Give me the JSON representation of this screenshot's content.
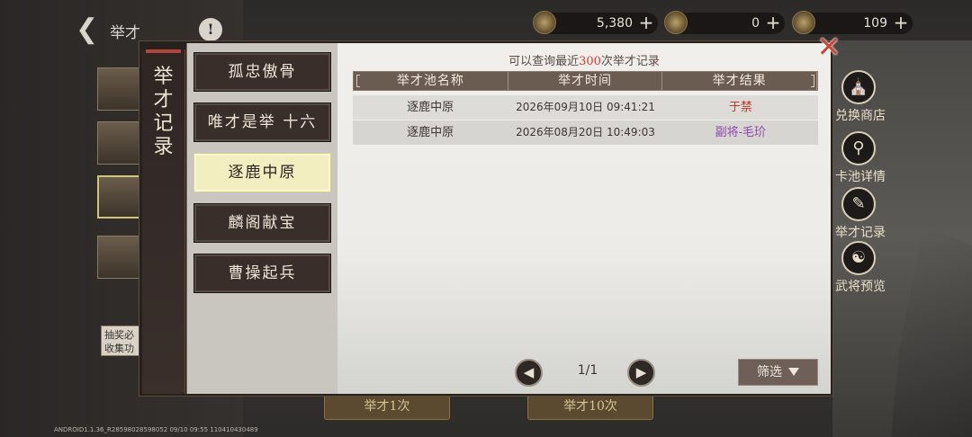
{
  "app": {
    "title": "举才",
    "version": "ANDROID1.1.36_R28598028598052 09/10 09:55 110410430489"
  },
  "currencies": [
    {
      "value": "5,380",
      "icon": "coin-icon"
    },
    {
      "value": "0",
      "icon": "jade-icon"
    },
    {
      "value": "109",
      "icon": "gem-icon"
    }
  ],
  "sidebar_background": {
    "collect_note": "抽奖必\n收集功",
    "shortcuts": [
      {
        "label": "兑换商店",
        "icon": "shop-icon"
      },
      {
        "label": "卡池详情",
        "icon": "magnifier-icon"
      },
      {
        "label": "举才记录",
        "icon": "brush-icon"
      },
      {
        "label": "武将预览",
        "icon": "hero-preview-icon"
      }
    ],
    "bottom_tabs": [
      "举才1次",
      "举才10次"
    ]
  },
  "modal": {
    "title_lines": [
      "举",
      "才",
      "记",
      "录"
    ],
    "tabs": [
      {
        "label": "孤忠傲骨",
        "active": false
      },
      {
        "label": "唯才是举 十六",
        "active": false
      },
      {
        "label": "逐鹿中原",
        "active": true
      },
      {
        "label": "麟阁献宝",
        "active": false
      },
      {
        "label": "曹操起兵",
        "active": false
      }
    ],
    "notice_prefix": "可以查询最近",
    "notice_count": "300",
    "notice_suffix": "次举才记录",
    "columns": [
      "举才池名称",
      "举才时间",
      "举才结果"
    ],
    "rows": [
      {
        "pool": "逐鹿中原",
        "time": "2026年09月10日  09:41:21",
        "result": "于禁",
        "result_color": "#c0392b"
      },
      {
        "pool": "逐鹿中原",
        "time": "2026年08月20日  10:49:03",
        "result": "副将-毛玠",
        "result_color": "#8e44ad"
      }
    ],
    "page_text": "1/1",
    "filter_label": "筛选",
    "close_symbol": "✕"
  }
}
